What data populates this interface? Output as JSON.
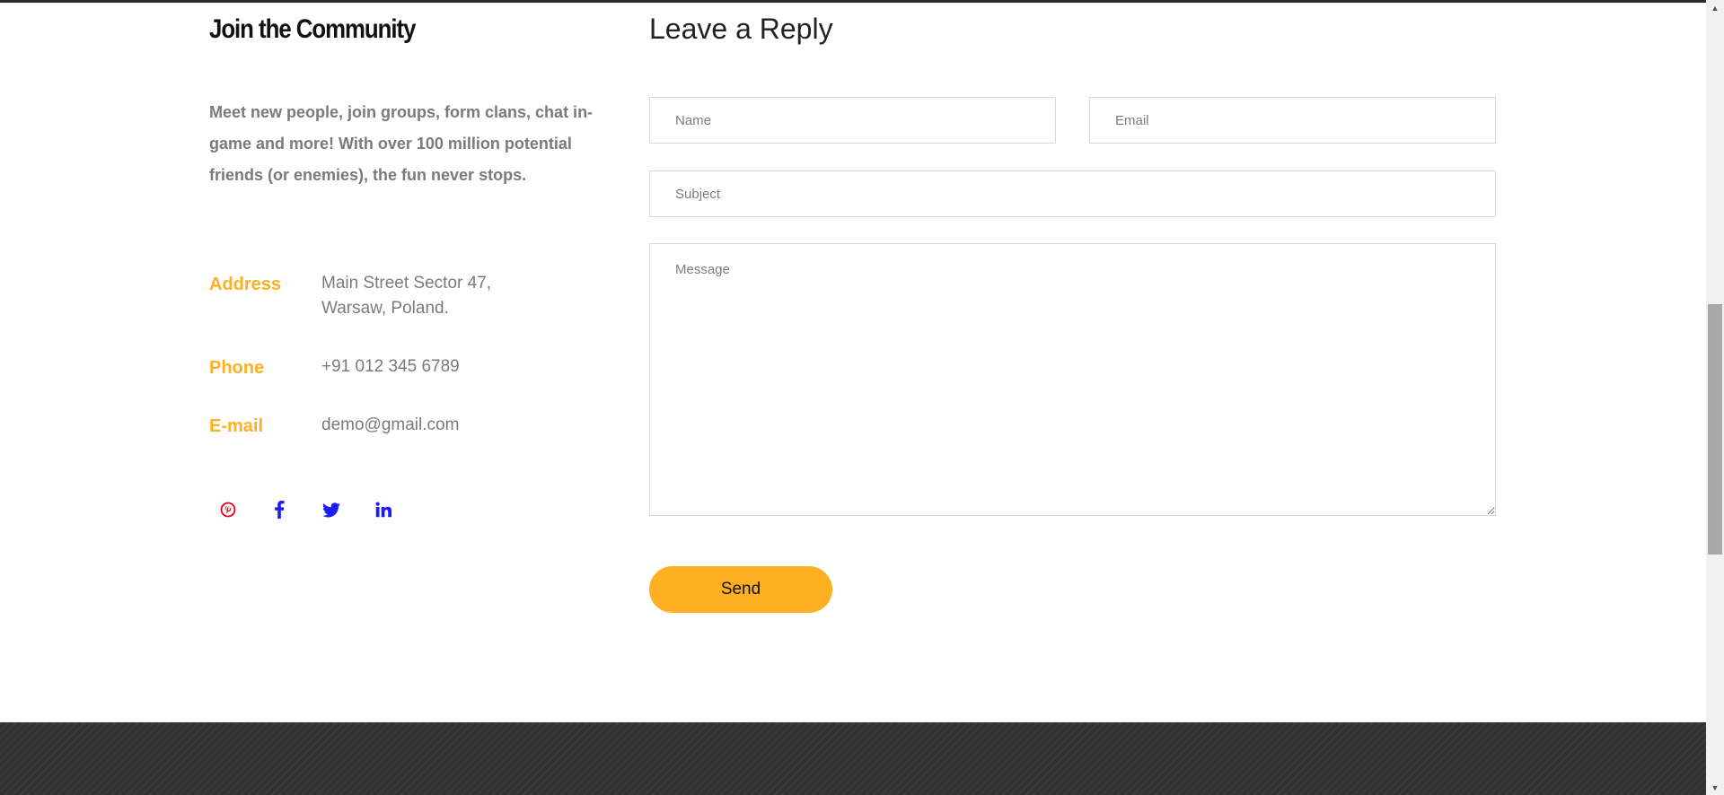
{
  "community": {
    "title": "Join the Community",
    "description": "Meet new people, join groups, form clans, chat in-game and more! With over 100 million potential friends (or enemies), the fun never stops."
  },
  "contact": {
    "address_label": "Address",
    "address_value": "Main Street Sector 47,\nWarsaw, Poland.",
    "phone_label": "Phone",
    "phone_value": "+91 012 345 6789",
    "email_label": "E-mail",
    "email_value": "demo@gmail.com"
  },
  "social": {
    "icons": [
      "pinterest-icon",
      "facebook-icon",
      "twitter-icon",
      "linkedin-icon"
    ],
    "colors": {
      "pinterest": "#e60023",
      "others": "#1a1aff"
    }
  },
  "form": {
    "title": "Leave a Reply",
    "name_placeholder": "Name",
    "email_placeholder": "Email",
    "subject_placeholder": "Subject",
    "message_placeholder": "Message",
    "send_label": "Send"
  },
  "colors": {
    "accent": "#ffaf21",
    "footer": "#333333"
  }
}
